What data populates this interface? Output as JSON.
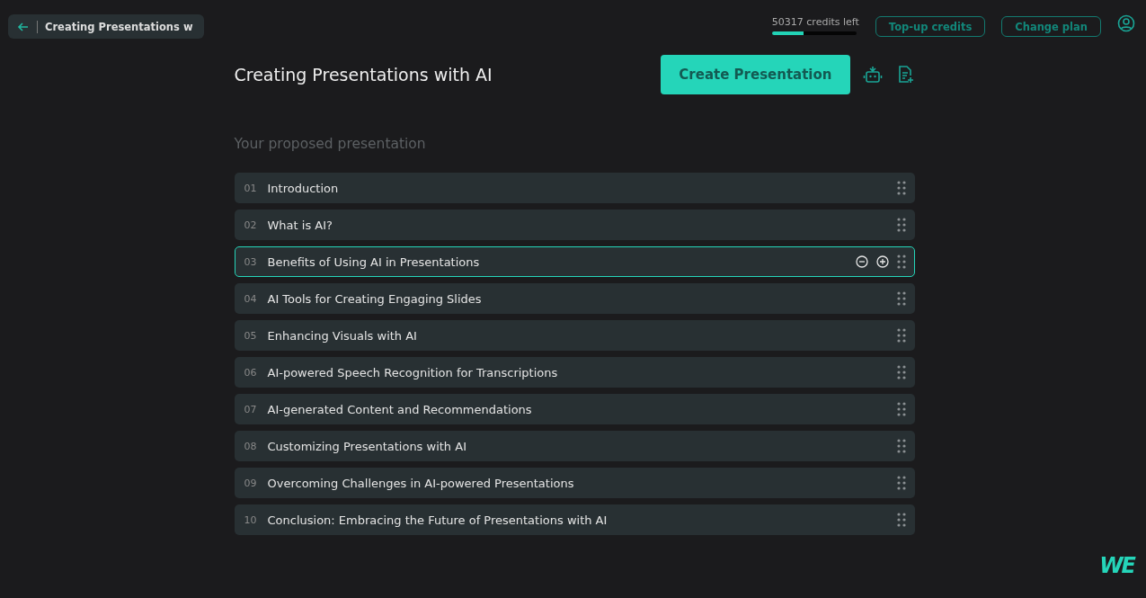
{
  "topbar": {
    "breadcrumb": "Creating Presentations w",
    "credits": {
      "label": "50317 credits left",
      "level": 0.37
    },
    "buttons": [
      "Top-up credits",
      "Change plan"
    ]
  },
  "header": {
    "title": "Creating Presentations with AI",
    "create_button": "Create Presentation"
  },
  "section_label": "Your proposed presentation",
  "slides": [
    {
      "number": "01",
      "title": "Introduction",
      "selected": false
    },
    {
      "number": "02",
      "title": "What is AI?",
      "selected": false
    },
    {
      "number": "03",
      "title": "Benefits of Using AI in Presentations",
      "selected": true
    },
    {
      "number": "04",
      "title": "AI Tools for Creating Engaging Slides",
      "selected": false
    },
    {
      "number": "05",
      "title": "Enhancing Visuals with AI",
      "selected": false
    },
    {
      "number": "06",
      "title": "AI-powered Speech Recognition for Transcriptions",
      "selected": false
    },
    {
      "number": "07",
      "title": "AI-generated Content and Recommendations",
      "selected": false
    },
    {
      "number": "08",
      "title": "Customizing Presentations with AI",
      "selected": false
    },
    {
      "number": "09",
      "title": "Overcoming Challenges in AI-powered Presentations",
      "selected": false
    },
    {
      "number": "10",
      "title": "Conclusion: Embracing the Future of Presentations with AI",
      "selected": false
    }
  ],
  "logo": "WE"
}
